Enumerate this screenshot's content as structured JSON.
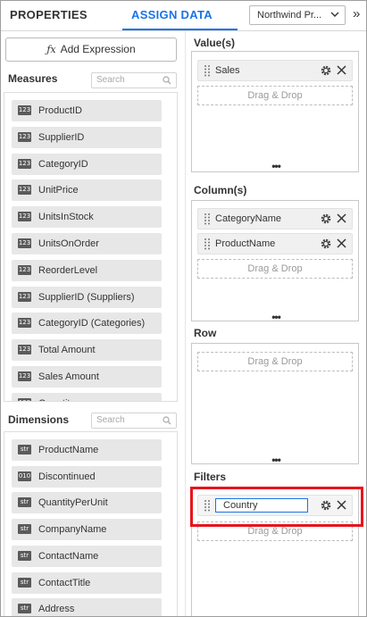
{
  "tabs": {
    "properties": "PROPERTIES",
    "assign_data": "ASSIGN DATA"
  },
  "datasource": {
    "value": "Northwind Pr..."
  },
  "collapse_glyph": "»",
  "add_expression": {
    "label": "Add Expression",
    "icon_text": "ƒx"
  },
  "measures": {
    "title": "Measures",
    "search_placeholder": "Search",
    "badge": "123",
    "items": [
      "ProductID",
      "SupplierID",
      "CategoryID",
      "UnitPrice",
      "UnitsInStock",
      "UnitsOnOrder",
      "ReorderLevel",
      "SupplierID (Suppliers)",
      "CategoryID (Categories)",
      "Total Amount",
      "Sales Amount",
      "Quantity"
    ]
  },
  "dimensions": {
    "title": "Dimensions",
    "search_placeholder": "Search",
    "items": [
      {
        "badge": "str",
        "label": "ProductName"
      },
      {
        "badge": "010",
        "label": "Discontinued"
      },
      {
        "badge": "str",
        "label": "QuantityPerUnit"
      },
      {
        "badge": "str",
        "label": "CompanyName"
      },
      {
        "badge": "str",
        "label": "ContactName"
      },
      {
        "badge": "str",
        "label": "ContactTitle"
      },
      {
        "badge": "str",
        "label": "Address"
      }
    ]
  },
  "zones": {
    "values": {
      "title": "Value(s)",
      "items": [
        "Sales"
      ],
      "drop_text": "Drag & Drop"
    },
    "columns": {
      "title": "Column(s)",
      "items": [
        "CategoryName",
        "ProductName"
      ],
      "drop_text": "Drag & Drop"
    },
    "row": {
      "title": "Row",
      "items": [],
      "drop_text": "Drag & Drop"
    },
    "filters": {
      "title": "Filters",
      "editing_value": "Country",
      "drop_text": "Drag & Drop"
    }
  },
  "colors": {
    "accent": "#1a73e8",
    "highlight": "#e8141c"
  }
}
